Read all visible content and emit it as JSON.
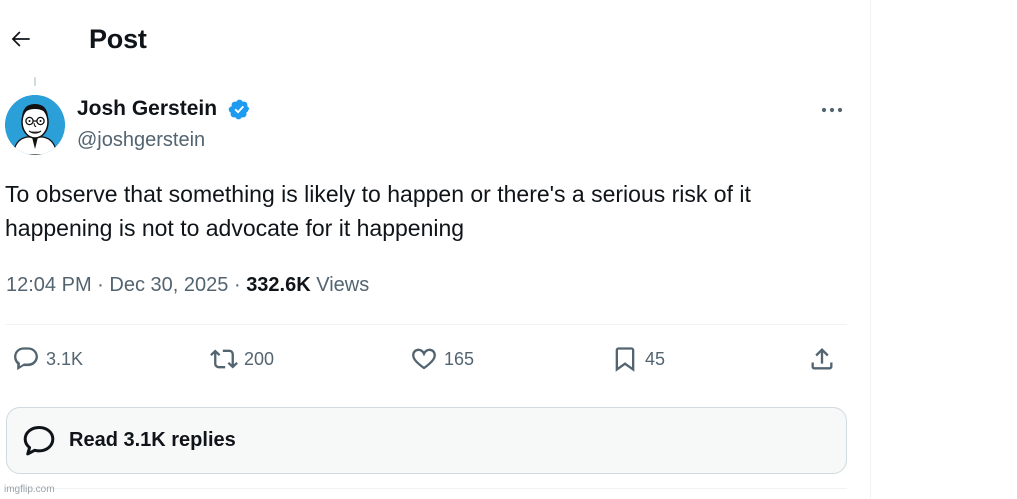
{
  "header": {
    "title": "Post",
    "back_icon": "arrow-left-icon"
  },
  "author": {
    "name": "Josh Gerstein",
    "handle": "@joshgerstein",
    "verified": true,
    "verified_color": "#1d9bf0"
  },
  "tweet": {
    "text": "To observe that something is likely to happen or there's a serious risk of it happening is not to advocate for it happening",
    "time": "12:04 PM",
    "separator": "·",
    "date": "Dec 30, 2025",
    "views_count": "332.6K",
    "views_label": "Views"
  },
  "actions": {
    "replies": "3.1K",
    "reposts": "200",
    "likes": "165",
    "bookmarks": "45"
  },
  "read_replies_label": "Read 3.1K replies",
  "watermark": "imgflip.com",
  "colors": {
    "text_primary": "#0f1419",
    "text_secondary": "#536471",
    "accent": "#1d9bf0",
    "border": "#cfd9de"
  }
}
